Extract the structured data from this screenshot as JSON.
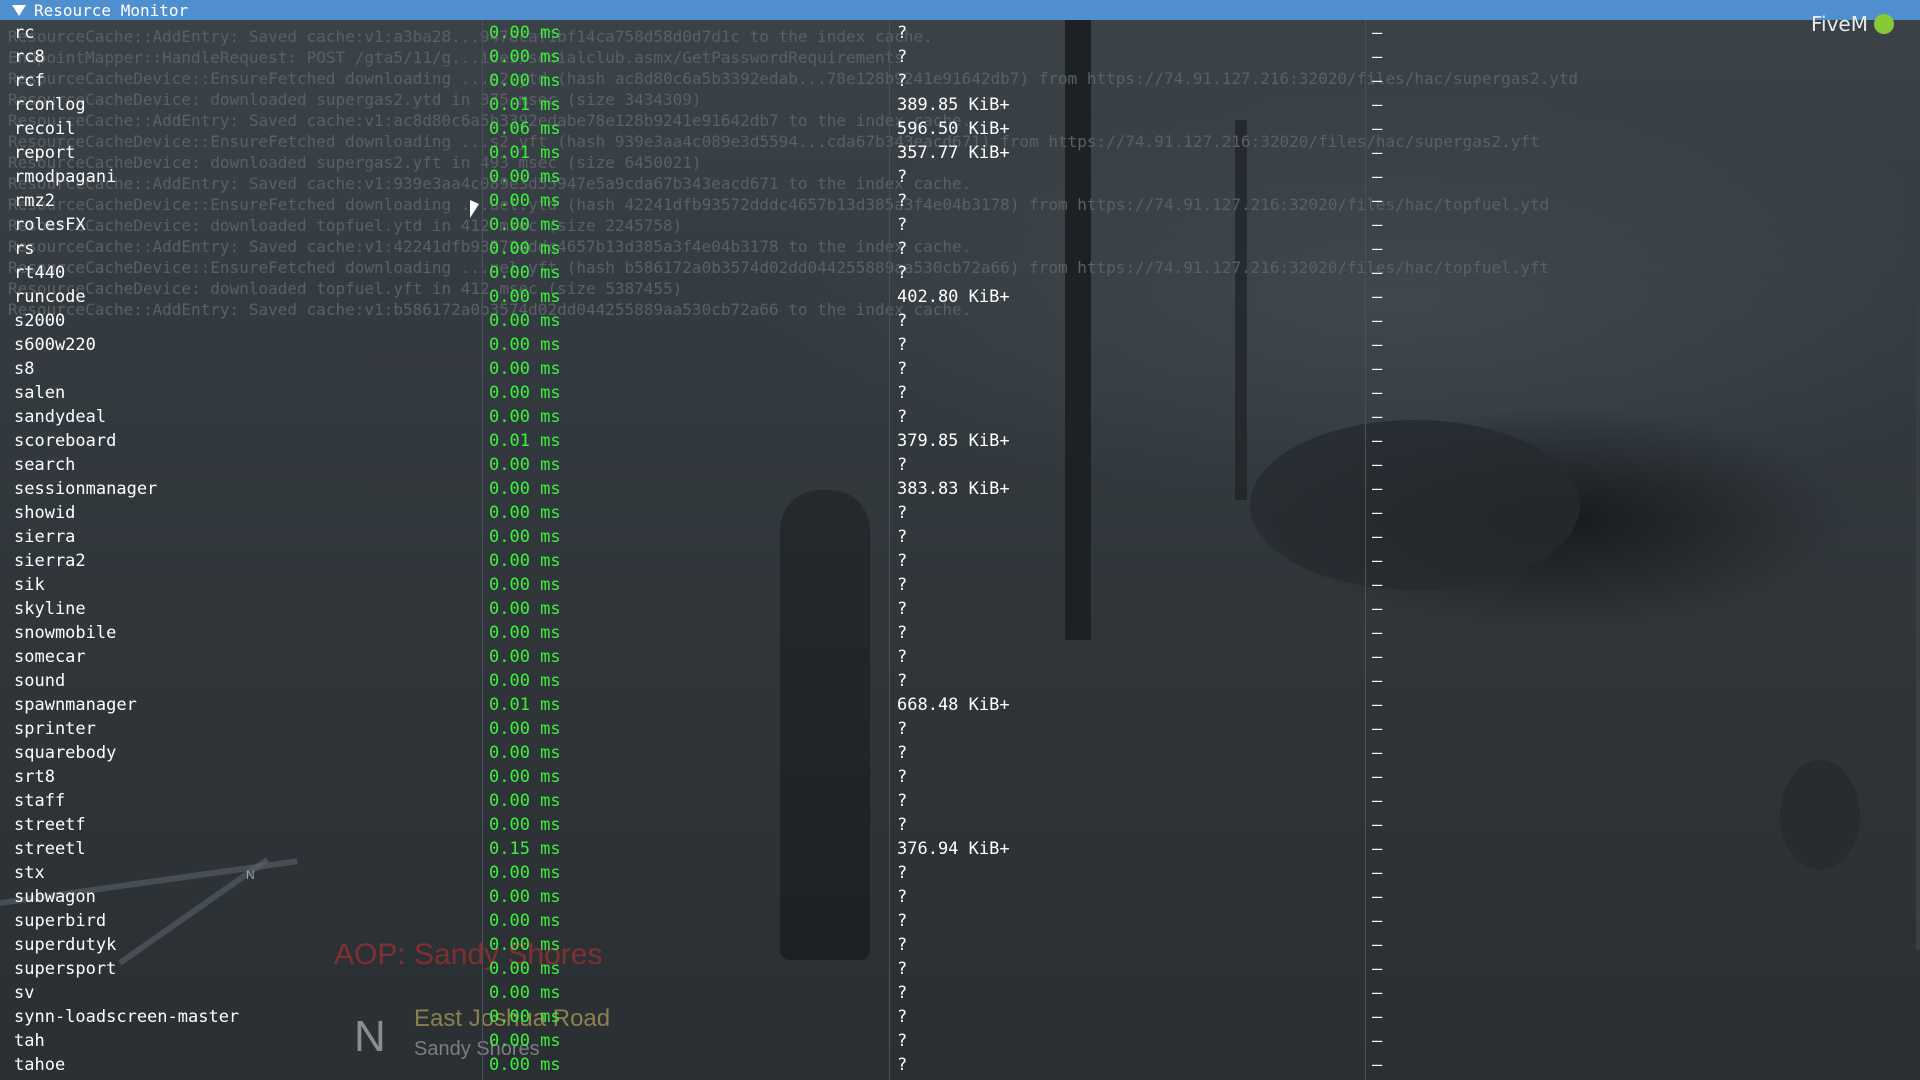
{
  "window": {
    "title": "Resource Monitor"
  },
  "brand": {
    "name": "FiveM",
    "logo_color": "#86c935"
  },
  "colors": {
    "titlebar": "#4f8fd0",
    "time": "#3ef03e",
    "text": "#ffffff"
  },
  "console_lines": [
    "ResourceCache::AddEntry: Saved cache:v1:a3ba28...9478caf1bf14ca758d58d0d7d1c to the index cache.",
    "EndpointMapper::HandleRequest: POST /gta5/11/g...ices/socialclub.asmx/GetPasswordRequirements",
    "ResourceCacheDevice::EnsureFetched downloading ...s2.ytd (hash ac8d80c6a5b3392edab...78e128b9241e91642db7) from https://74.91.127.216:32020/files/hac/supergas2.ytd",
    "ResourceCacheDevice: downloaded supergas2.ytd in 375 msec (size 3434309)",
    "ResourceCache::AddEntry: Saved cache:v1:ac8d80c6a5b3392edabe78e128b9241e91642db7 to the index cache.",
    "ResourceCacheDevice::EnsureFetched downloading ...s2.yft (hash 939e3aa4c089e3d5594...cda67b343eacd671) from https://74.91.127.216:32020/files/hac/supergas2.yft",
    "ResourceCacheDevice: downloaded supergas2.yft in 493 msec (size 6450021)",
    "ResourceCache::AddEntry: Saved cache:v1:939e3aa4c089e3d55947e5a9cda67b343eacd671 to the index cache.",
    "ResourceCacheDevice::EnsureFetched downloading ...uel.ytd (hash 42241dfb93572dddc4657b13d385a3f4e04b3178) from https://74.91.127.216:32020/files/hac/topfuel.ytd",
    "ResourceCacheDevice: downloaded topfuel.ytd in 412 msec (size 2245758)",
    "ResourceCache::AddEntry: Saved cache:v1:42241dfb93572dddc4657b13d385a3f4e04b3178 to the index cache.",
    "ResourceCacheDevice::EnsureFetched downloading ...uel.yft (hash b586172a0b3574d02dd044255889aa530cb72a66) from https://74.91.127.216:32020/files/hac/topfuel.yft",
    "ResourceCacheDevice: downloaded topfuel.yft in 412 msec (size 5387455)",
    "ResourceCache::AddEntry: Saved cache:v1:b586172a0b3574d02dd044255889aa530cb72a66 to the index cache."
  ],
  "resources": [
    {
      "name": "rc",
      "time": "0.00 ms",
      "mem": "?",
      "extra": "–"
    },
    {
      "name": "rc8",
      "time": "0.00 ms",
      "mem": "?",
      "extra": "–"
    },
    {
      "name": "rcf",
      "time": "0.00 ms",
      "mem": "?",
      "extra": "–"
    },
    {
      "name": "rconlog",
      "time": "0.01 ms",
      "mem": "389.85 KiB+",
      "extra": "–"
    },
    {
      "name": "recoil",
      "time": "0.06 ms",
      "mem": "596.50 KiB+",
      "extra": "–"
    },
    {
      "name": "report",
      "time": "0.01 ms",
      "mem": "357.77 KiB+",
      "extra": "–"
    },
    {
      "name": "rmodpagani",
      "time": "0.00 ms",
      "mem": "?",
      "extra": "–"
    },
    {
      "name": "rmz2",
      "time": "0.00 ms",
      "mem": "?",
      "extra": "–"
    },
    {
      "name": "rolesFX",
      "time": "0.00 ms",
      "mem": "?",
      "extra": "–"
    },
    {
      "name": "rs",
      "time": "0.00 ms",
      "mem": "?",
      "extra": "–"
    },
    {
      "name": "rt440",
      "time": "0.00 ms",
      "mem": "?",
      "extra": "–"
    },
    {
      "name": "runcode",
      "time": "0.00 ms",
      "mem": "402.80 KiB+",
      "extra": "–"
    },
    {
      "name": "s2000",
      "time": "0.00 ms",
      "mem": "?",
      "extra": "–"
    },
    {
      "name": "s600w220",
      "time": "0.00 ms",
      "mem": "?",
      "extra": "–"
    },
    {
      "name": "s8",
      "time": "0.00 ms",
      "mem": "?",
      "extra": "–"
    },
    {
      "name": "salen",
      "time": "0.00 ms",
      "mem": "?",
      "extra": "–"
    },
    {
      "name": "sandydeal",
      "time": "0.00 ms",
      "mem": "?",
      "extra": "–"
    },
    {
      "name": "scoreboard",
      "time": "0.01 ms",
      "mem": "379.85 KiB+",
      "extra": "–"
    },
    {
      "name": "search",
      "time": "0.00 ms",
      "mem": "?",
      "extra": "–"
    },
    {
      "name": "sessionmanager",
      "time": "0.00 ms",
      "mem": "383.83 KiB+",
      "extra": "–"
    },
    {
      "name": "showid",
      "time": "0.00 ms",
      "mem": "?",
      "extra": "–"
    },
    {
      "name": "sierra",
      "time": "0.00 ms",
      "mem": "?",
      "extra": "–"
    },
    {
      "name": "sierra2",
      "time": "0.00 ms",
      "mem": "?",
      "extra": "–"
    },
    {
      "name": "sik",
      "time": "0.00 ms",
      "mem": "?",
      "extra": "–"
    },
    {
      "name": "skyline",
      "time": "0.00 ms",
      "mem": "?",
      "extra": "–"
    },
    {
      "name": "snowmobile",
      "time": "0.00 ms",
      "mem": "?",
      "extra": "–"
    },
    {
      "name": "somecar",
      "time": "0.00 ms",
      "mem": "?",
      "extra": "–"
    },
    {
      "name": "sound",
      "time": "0.00 ms",
      "mem": "?",
      "extra": "–"
    },
    {
      "name": "spawnmanager",
      "time": "0.01 ms",
      "mem": "668.48 KiB+",
      "extra": "–"
    },
    {
      "name": "sprinter",
      "time": "0.00 ms",
      "mem": "?",
      "extra": "–"
    },
    {
      "name": "squarebody",
      "time": "0.00 ms",
      "mem": "?",
      "extra": "–"
    },
    {
      "name": "srt8",
      "time": "0.00 ms",
      "mem": "?",
      "extra": "–"
    },
    {
      "name": "staff",
      "time": "0.00 ms",
      "mem": "?",
      "extra": "–"
    },
    {
      "name": "streetf",
      "time": "0.00 ms",
      "mem": "?",
      "extra": "–"
    },
    {
      "name": "streetl",
      "time": "0.15 ms",
      "mem": "376.94 KiB+",
      "extra": "–"
    },
    {
      "name": "stx",
      "time": "0.00 ms",
      "mem": "?",
      "extra": "–"
    },
    {
      "name": "subwagon",
      "time": "0.00 ms",
      "mem": "?",
      "extra": "–"
    },
    {
      "name": "superbird",
      "time": "0.00 ms",
      "mem": "?",
      "extra": "–"
    },
    {
      "name": "superdutyk",
      "time": "0.00 ms",
      "mem": "?",
      "extra": "–"
    },
    {
      "name": "supersport",
      "time": "0.00 ms",
      "mem": "?",
      "extra": "–"
    },
    {
      "name": "sv",
      "time": "0.00 ms",
      "mem": "?",
      "extra": "–"
    },
    {
      "name": "synn-loadscreen-master",
      "time": "0.00 ms",
      "mem": "?",
      "extra": "–"
    },
    {
      "name": "tah",
      "time": "0.00 ms",
      "mem": "?",
      "extra": "–"
    },
    {
      "name": "tahoe",
      "time": "0.00 ms",
      "mem": "?",
      "extra": "–"
    }
  ],
  "hud": {
    "aop": "AOP: Sandy Shores",
    "compass": "N",
    "street": "East Joshua Road",
    "zone": "Sandy Shores",
    "minimap_north": "N"
  }
}
